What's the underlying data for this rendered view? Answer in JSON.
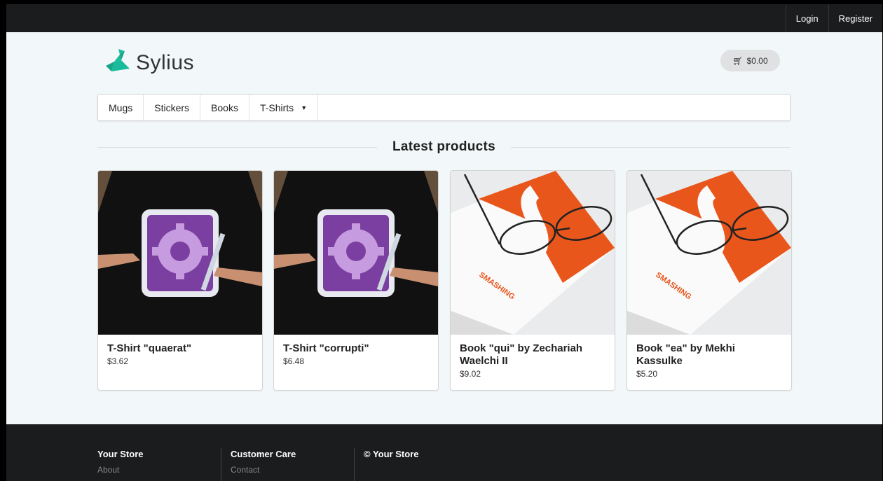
{
  "topbar": {
    "login_label": "Login",
    "register_label": "Register"
  },
  "header": {
    "brand": "Sylius",
    "cart_total": "$0.00"
  },
  "nav": {
    "items": [
      {
        "label": "Mugs"
      },
      {
        "label": "Stickers"
      },
      {
        "label": "Books"
      },
      {
        "label": "T-Shirts"
      }
    ]
  },
  "main": {
    "heading": "Latest products"
  },
  "products": [
    {
      "title": "T-Shirt \"quaerat\"",
      "price": "$3.62",
      "image": "tshirt-gear-image"
    },
    {
      "title": "T-Shirt \"corrupti\"",
      "price": "$6.48",
      "image": "tshirt-gear-image"
    },
    {
      "title": "Book \"qui\" by Zechariah Waelchi II",
      "price": "$9.02",
      "image": "smashing-book-image"
    },
    {
      "title": "Book \"ea\" by Mekhi Kassulke",
      "price": "$5.20",
      "image": "smashing-book-image"
    }
  ],
  "footer": {
    "columns": [
      {
        "heading": "Your Store",
        "first_link": "About"
      },
      {
        "heading": "Customer Care",
        "first_link": "Contact"
      },
      {
        "heading": "© Your Store",
        "first_link": ""
      }
    ]
  },
  "colors": {
    "brand_green": "#1abb9c",
    "topbar": "#1b1c1d",
    "page_bg": "#f2f8f9"
  }
}
